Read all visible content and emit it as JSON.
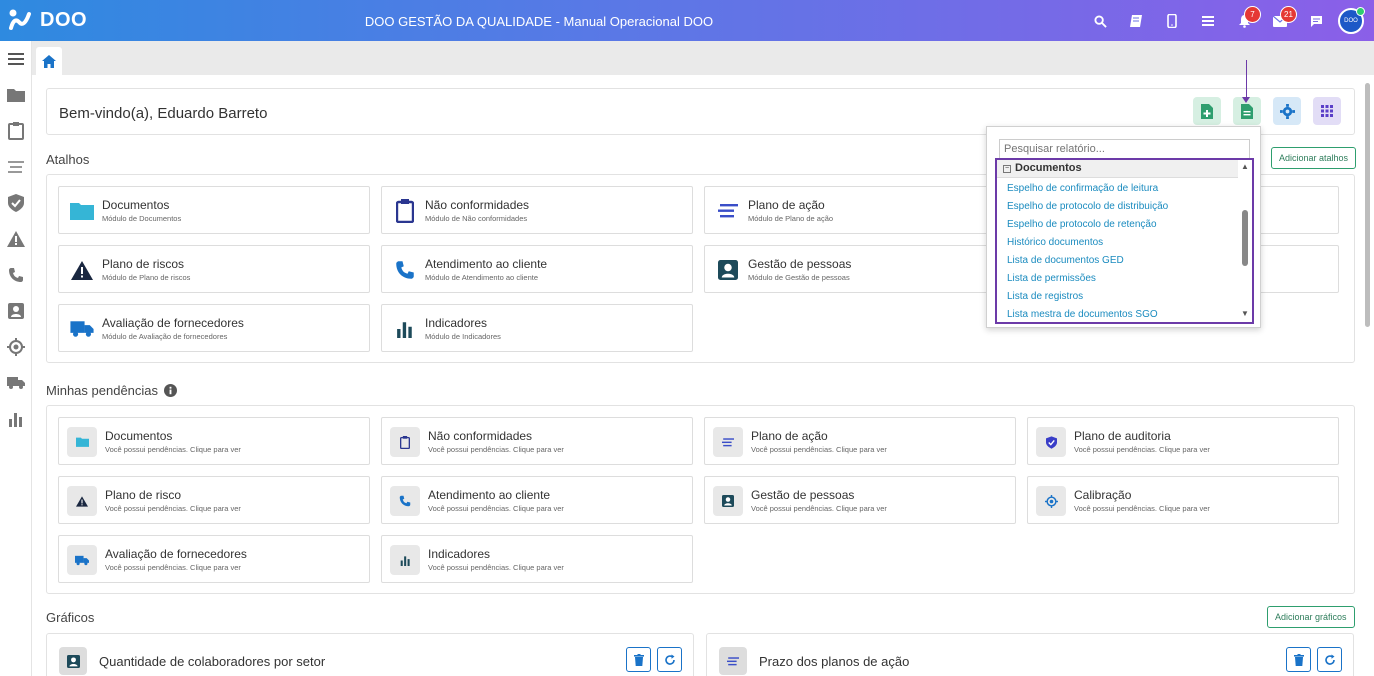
{
  "app": {
    "logo_text": "DOO",
    "title": "DOO GESTÃO DA QUALIDADE - Manual Operacional DOO",
    "avatar_text": "DOO"
  },
  "topbar": {
    "notifications_count": "7",
    "messages_count": "21"
  },
  "welcome": "Bem-vindo(a), Eduardo Barreto",
  "shortcuts": {
    "title": "Atalhos",
    "add_label": "Adicionar atalhos",
    "items": [
      {
        "title": "Documentos",
        "subtitle": "Módulo de Documentos",
        "icon": "folder-icon"
      },
      {
        "title": "Não conformidades",
        "subtitle": "Módulo de Não conformidades",
        "icon": "clipboard-icon"
      },
      {
        "title": "Plano de ação",
        "subtitle": "Módulo de Plano de ação",
        "icon": "lines-icon"
      },
      {
        "title": "Plano de riscos",
        "subtitle": "Módulo de Plano de riscos",
        "icon": "warning-icon"
      },
      {
        "title": "Atendimento ao cliente",
        "subtitle": "Módulo de Atendimento ao cliente",
        "icon": "phone-icon"
      },
      {
        "title": "Gestão de pessoas",
        "subtitle": "Módulo de Gestão de pessoas",
        "icon": "person-badge-icon"
      },
      {
        "title": "Avaliação de fornecedores",
        "subtitle": "Módulo de Avaliação de fornecedores",
        "icon": "truck-icon"
      },
      {
        "title": "Indicadores",
        "subtitle": "Módulo de Indicadores",
        "icon": "bar-chart-icon"
      }
    ]
  },
  "pending": {
    "title": "Minhas pendências",
    "subtitle": "Você possui pendências. Clique para ver",
    "items": [
      {
        "title": "Documentos"
      },
      {
        "title": "Não conformidades"
      },
      {
        "title": "Plano de ação"
      },
      {
        "title": "Plano de auditoria"
      },
      {
        "title": "Plano de risco"
      },
      {
        "title": "Atendimento ao cliente"
      },
      {
        "title": "Gestão de pessoas"
      },
      {
        "title": "Calibração"
      },
      {
        "title": "Avaliação de fornecedores"
      },
      {
        "title": "Indicadores"
      }
    ]
  },
  "charts": {
    "title": "Gráficos",
    "add_label": "Adicionar gráficos",
    "items": [
      {
        "title": "Quantidade de colaboradores por setor"
      },
      {
        "title": "Prazo dos planos de ação"
      }
    ]
  },
  "report_dropdown": {
    "search_placeholder": "Pesquisar relatório...",
    "group": "Documentos",
    "items": [
      "Espelho de confirmação de leitura",
      "Espelho de protocolo de distribuição",
      "Espelho de protocolo de retenção",
      "Histórico documentos",
      "Lista de documentos GED",
      "Lista de permissões",
      "Lista de registros",
      "Lista mestra de documentos SGO"
    ]
  },
  "colors": {
    "accent_green": "#2e9e6e",
    "accent_purple": "#6c3aa8",
    "link_blue": "#1a8bbf"
  }
}
